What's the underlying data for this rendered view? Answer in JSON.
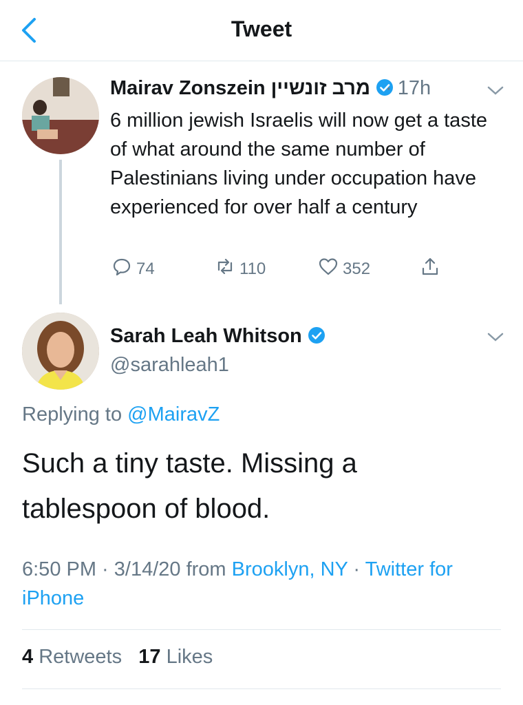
{
  "header": {
    "title": "Tweet",
    "back_icon": "back-chevron-icon"
  },
  "colors": {
    "accent": "#1da1f2",
    "secondary_text": "#657786",
    "primary_text": "#14171a"
  },
  "tweet1": {
    "display_name": "Mairav Zonszein מרב זונשיין",
    "verified": true,
    "time": "· 17h",
    "text": "6 million jewish Israelis will now get a taste of what around the same number of Palestinians living under occupation have experienced for over half a century",
    "actions": {
      "replies": "74",
      "retweets": "110",
      "likes": "352"
    }
  },
  "tweet2": {
    "display_name": "Sarah Leah Whitson",
    "verified": true,
    "handle": "@sarahleah1",
    "replying_prefix": "Replying to ",
    "replying_to": "@MairavZ",
    "text": "Such a tiny taste. Missing a tablespoon of blood.",
    "time": "6:50 PM · 3/14/20 from ",
    "location": "Brooklyn, NY",
    "sep": " · ",
    "source": "Twitter for iPhone",
    "retweets_count": "4",
    "retweets_label": "Retweets",
    "likes_count": "17",
    "likes_label": "Likes"
  }
}
